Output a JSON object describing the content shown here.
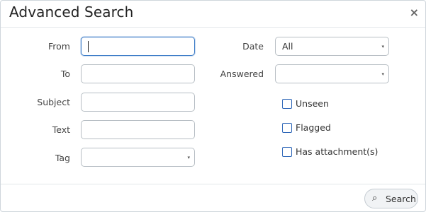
{
  "dialog": {
    "title": "Advanced Search",
    "close_glyph": "×"
  },
  "left_fields": {
    "from_label": "From",
    "from_value": "",
    "to_label": "To",
    "to_value": "",
    "subject_label": "Subject",
    "subject_value": "",
    "text_label": "Text",
    "text_value": "",
    "tag_label": "Tag",
    "tag_value": ""
  },
  "right_fields": {
    "date_label": "Date",
    "date_value": "All",
    "answered_label": "Answered",
    "answered_value": ""
  },
  "checkboxes": {
    "unseen": {
      "label": "Unseen",
      "checked": false
    },
    "flagged": {
      "label": "Flagged",
      "checked": false
    },
    "attachment": {
      "label": "Has attachment(s)",
      "checked": false
    }
  },
  "footer": {
    "search_label": "Search",
    "search_icon": "search-icon"
  },
  "icons": {
    "dropdown": "▾",
    "search": "⌕"
  },
  "colors": {
    "focus_border": "#3d7cc7",
    "checkbox_border": "#2f67b8"
  }
}
